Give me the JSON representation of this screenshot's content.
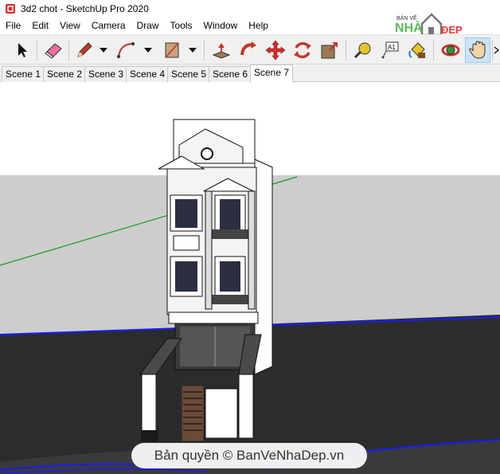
{
  "window": {
    "title": "3d2 chot - SketchUp Pro 2020"
  },
  "menu": [
    "File",
    "Edit",
    "View",
    "Camera",
    "Draw",
    "Tools",
    "Window",
    "Help"
  ],
  "logo": {
    "line1": "BẢN VẼ",
    "line2": "NHÀ",
    "line3": "ĐẸP",
    "colors": {
      "green": "#5cb85c",
      "red": "#e53935",
      "gray": "#777777"
    }
  },
  "scenes": [
    "Scene 1",
    "Scene 2",
    "Scene 3",
    "Scene 4",
    "Scene 5",
    "Scene 6",
    "Scene 7"
  ],
  "active_scene": "Scene 7",
  "toolbar": {
    "tools": [
      "select-tool",
      "eraser-tool",
      "line-tool",
      "arc-tool",
      "rectangle-tool",
      "push-pull-tool",
      "follow-me-tool",
      "move-tool",
      "rotate-tool",
      "scale-tool",
      "tape-measure-tool",
      "text-tool",
      "paint-bucket-tool",
      "orbit-tool",
      "pan-tool"
    ],
    "active_tool": "pan-tool"
  },
  "watermark": {
    "text": "Bản quyền © BanVeNhaDep.vn"
  },
  "colors": {
    "sky": "#ffffff",
    "ground": "#cdcdcd",
    "axis_green": "#1a9e1a",
    "axis_blue": "#1a1aff"
  }
}
